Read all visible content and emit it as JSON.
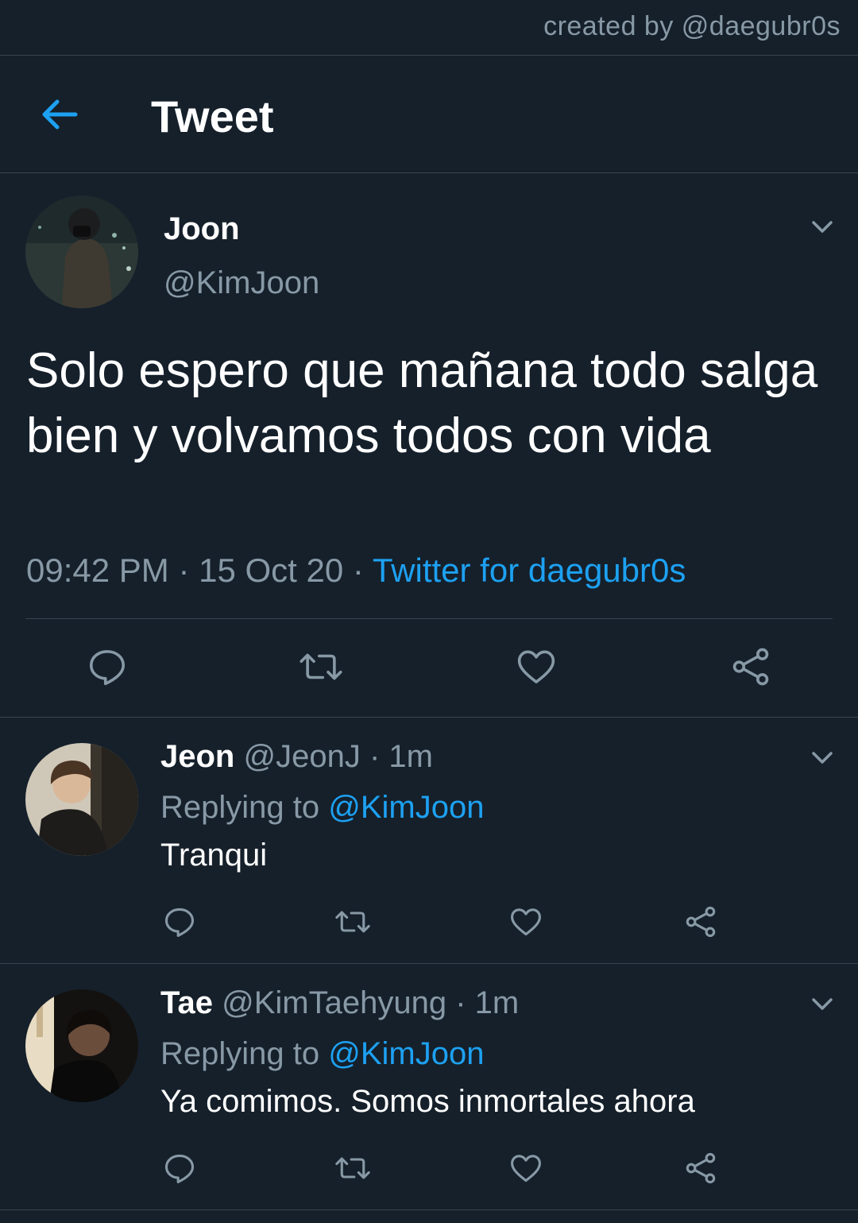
{
  "watermark": "created by @daegubr0s",
  "header": {
    "title": "Tweet"
  },
  "main_tweet": {
    "name": "Joon",
    "handle": "@KimJoon",
    "text": "Solo espero que mañana todo salga bien y volvamos todos con vida",
    "time": "09:42 PM",
    "separator": "·",
    "date": "15 Oct 20",
    "source": "Twitter for daegubr0s"
  },
  "replies": [
    {
      "name": "Jeon",
      "handle": "@JeonJ",
      "separator": "·",
      "time": "1m",
      "replying_label": "Replying to",
      "replying_to": "@KimJoon",
      "text": "Tranqui"
    },
    {
      "name": "Tae",
      "handle": "@KimTaehyung",
      "separator": "·",
      "time": "1m",
      "replying_label": "Replying to",
      "replying_to": "@KimJoon",
      "text": "Ya comimos. Somos inmortales ahora"
    }
  ],
  "colors": {
    "background": "#15202b",
    "divider": "#38444d",
    "secondary_text": "#8899a6",
    "accent": "#1da1f2"
  },
  "icons": [
    "back-arrow-icon",
    "chevron-down-icon",
    "reply-icon",
    "retweet-icon",
    "like-icon",
    "share-icon"
  ]
}
